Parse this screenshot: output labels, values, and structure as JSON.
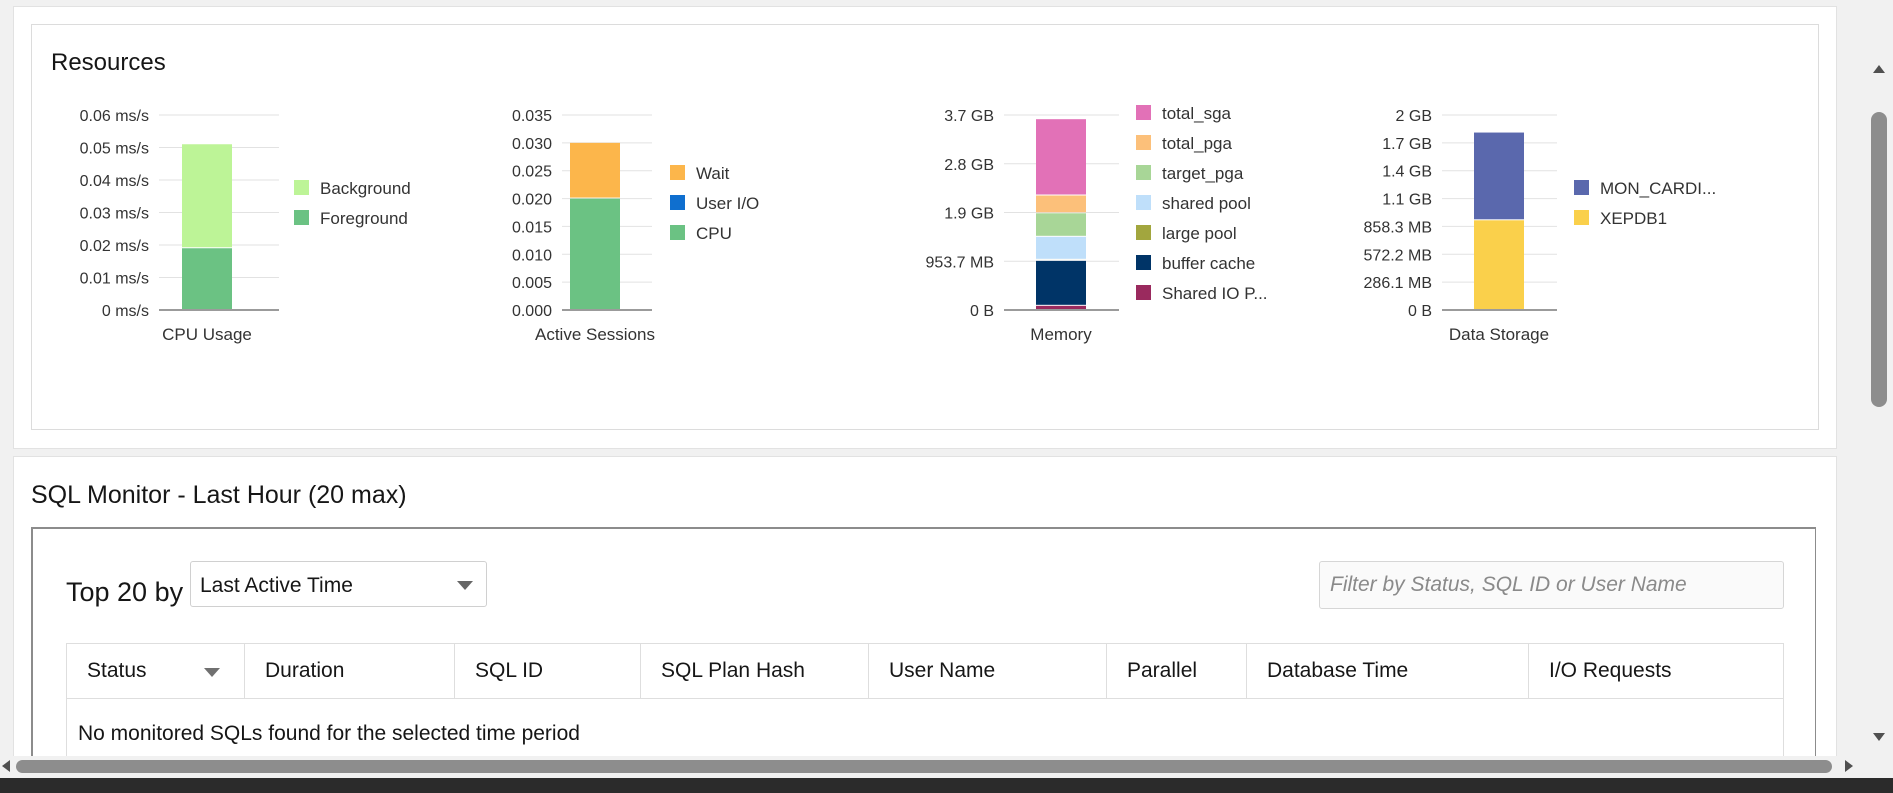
{
  "resources": {
    "title": "Resources"
  },
  "chart_data": [
    {
      "type": "bar",
      "stacked": true,
      "title": "",
      "xlabel": "CPU Usage",
      "categories": [
        "CPU Usage"
      ],
      "yticks": [
        "0 ms/s",
        "0.01 ms/s",
        "0.02 ms/s",
        "0.03 ms/s",
        "0.04 ms/s",
        "0.05 ms/s",
        "0.06 ms/s"
      ],
      "ylim": [
        0,
        0.06
      ],
      "legend_position": "right",
      "series": [
        {
          "name": "Foreground",
          "values": [
            0.019
          ],
          "color": "#6bc283"
        },
        {
          "name": "Background",
          "values": [
            0.032
          ],
          "color": "#bdf497"
        }
      ]
    },
    {
      "type": "bar",
      "stacked": true,
      "title": "",
      "xlabel": "Active Sessions",
      "categories": [
        "Active Sessions"
      ],
      "yticks": [
        "0.000",
        "0.005",
        "0.010",
        "0.015",
        "0.020",
        "0.025",
        "0.030",
        "0.035"
      ],
      "ylim": [
        0,
        0.035
      ],
      "legend_position": "right",
      "series": [
        {
          "name": "CPU",
          "values": [
            0.02
          ],
          "color": "#6bc283"
        },
        {
          "name": "User I/O",
          "values": [
            0
          ],
          "color": "#0f6fcf"
        },
        {
          "name": "Wait",
          "values": [
            0.01
          ],
          "color": "#fcb64b"
        }
      ]
    },
    {
      "type": "bar",
      "stacked": true,
      "title": "",
      "xlabel": "Memory",
      "categories": [
        "Memory"
      ],
      "yticks": [
        "0 B",
        "953.7 MB",
        "1.9 GB",
        "2.8 GB",
        "3.7 GB"
      ],
      "ylim": [
        0,
        3.73
      ],
      "y_unit": "GB",
      "legend_position": "right",
      "series": [
        {
          "name": "Shared IO P...",
          "values": [
            0.08
          ],
          "color": "#9a2a5e"
        },
        {
          "name": "buffer cache",
          "values": [
            0.86
          ],
          "color": "#003467"
        },
        {
          "name": "large pool",
          "values": [
            0.02
          ],
          "color": "#a2a63e"
        },
        {
          "name": "shared pool",
          "values": [
            0.44
          ],
          "color": "#bfdffa"
        },
        {
          "name": "target_pga",
          "values": [
            0.45
          ],
          "color": "#a8d697"
        },
        {
          "name": "total_pga",
          "values": [
            0.34
          ],
          "color": "#fcc07a"
        },
        {
          "name": "total_sga",
          "values": [
            1.46
          ],
          "color": "#e271b7"
        }
      ]
    },
    {
      "type": "bar",
      "stacked": true,
      "title": "",
      "xlabel": "Data Storage",
      "categories": [
        "Data Storage"
      ],
      "yticks": [
        "0 B",
        "286.1 MB",
        "572.2 MB",
        "858.3 MB",
        "1.1 GB",
        "1.4 GB",
        "1.7 GB",
        "2 GB"
      ],
      "ylim": [
        0,
        2.0
      ],
      "y_unit": "GB",
      "legend_position": "right",
      "series": [
        {
          "name": "XEPDB1",
          "values": [
            0.92
          ],
          "color": "#fad04b"
        },
        {
          "name": "MON_CARDI...",
          "values": [
            0.9
          ],
          "color": "#5a68ad"
        }
      ]
    }
  ],
  "sql_monitor": {
    "title": "SQL Monitor - Last Hour (20 max)",
    "top_label": "Top 20 by",
    "sort_select": "Last Active Time",
    "filter_placeholder": "Filter by Status, SQL ID or User Name",
    "columns": [
      "Status",
      "Duration",
      "SQL ID",
      "SQL Plan Hash",
      "User Name",
      "Parallel",
      "Database Time",
      "I/O Requests"
    ],
    "empty_message": "No monitored SQLs found for the selected time period"
  }
}
